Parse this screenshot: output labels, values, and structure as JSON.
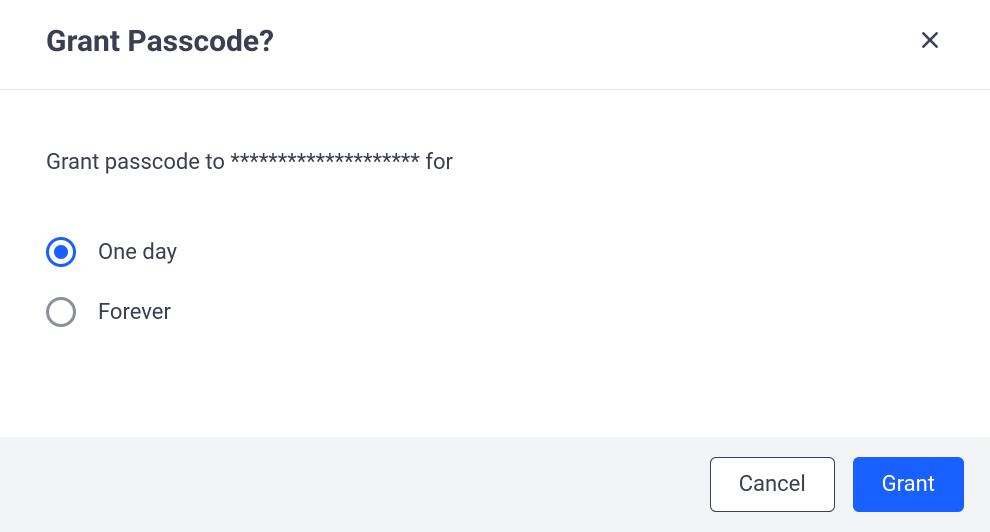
{
  "header": {
    "title": "Grant Passcode?"
  },
  "body": {
    "prompt_prefix": "Grant passcode to ",
    "prompt_masked": "********************",
    "prompt_suffix": " for",
    "options": [
      {
        "label": "One day",
        "selected": true
      },
      {
        "label": "Forever",
        "selected": false
      }
    ]
  },
  "footer": {
    "cancel_label": "Cancel",
    "grant_label": "Grant"
  }
}
